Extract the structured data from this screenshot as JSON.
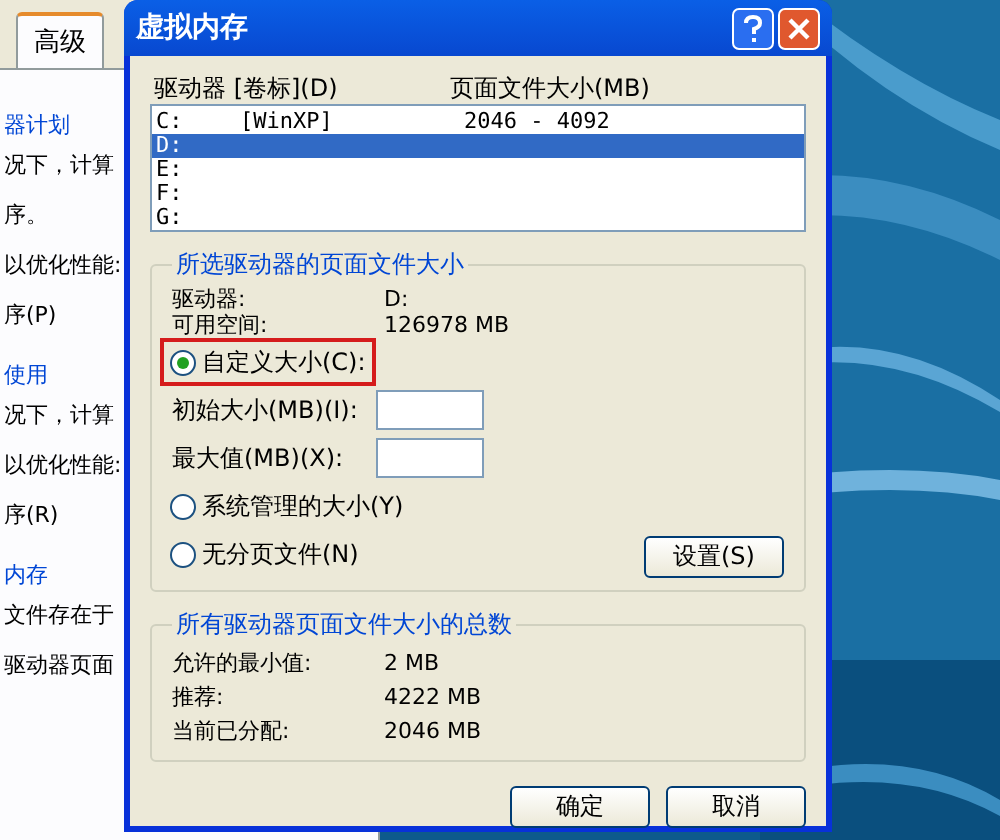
{
  "background_window": {
    "tabs": [
      {
        "label": "高级",
        "selected": true
      }
    ],
    "lines": [
      {
        "kind": "heading",
        "text": "器计划"
      },
      {
        "kind": "text",
        "text": "况下，计算"
      },
      {
        "kind": "text",
        "text": "序。"
      },
      {
        "kind": "text",
        "text": "以优化性能:"
      },
      {
        "kind": "text",
        "text": "序(P)"
      },
      {
        "kind": "heading",
        "text": "使用"
      },
      {
        "kind": "text",
        "text": "况下，计算"
      },
      {
        "kind": "text",
        "text": "以优化性能:"
      },
      {
        "kind": "text",
        "text": "序(R)"
      },
      {
        "kind": "heading",
        "text": "内存"
      },
      {
        "kind": "text",
        "text": "文件存在于"
      },
      {
        "kind": "text",
        "text": "驱动器页面"
      }
    ]
  },
  "dialog": {
    "title": "虚拟内存",
    "list": {
      "columns": [
        "驱动器 [卷标](D)",
        "页面文件大小(MB)"
      ],
      "rows": [
        {
          "drive": "C:",
          "label": "[WinXP]",
          "size": "2046 - 4092",
          "selected": false
        },
        {
          "drive": "D:",
          "selected": true
        },
        {
          "drive": "E:",
          "selected": false
        },
        {
          "drive": "F:",
          "selected": false
        },
        {
          "drive": "G:",
          "selected": false
        }
      ]
    },
    "selected_drive_group": {
      "title": "所选驱动器的页面文件大小",
      "info": [
        {
          "label": "驱动器:",
          "value": "D:"
        },
        {
          "label": "可用空间:",
          "value": "126978 MB"
        }
      ],
      "size_options": [
        {
          "label": "自定义大小(C):",
          "selected": true,
          "highlighted": true,
          "fields": [
            {
              "label": "初始大小(MB)(I):"
            },
            {
              "label": "最大值(MB)(X):"
            }
          ]
        },
        {
          "label": "系统管理的大小(Y)",
          "selected": false,
          "highlighted": false
        },
        {
          "label": "无分页文件(N)",
          "selected": false,
          "highlighted": false
        }
      ],
      "set_button": "设置(S)"
    },
    "totals_group": {
      "title": "所有驱动器页面文件大小的总数",
      "rows": [
        {
          "label": "允许的最小值:",
          "value": "2 MB"
        },
        {
          "label": "推荐:",
          "value": "4222 MB"
        },
        {
          "label": "当前已分配:",
          "value": "2046 MB"
        }
      ]
    },
    "buttons": [
      "确定",
      "取消"
    ]
  }
}
